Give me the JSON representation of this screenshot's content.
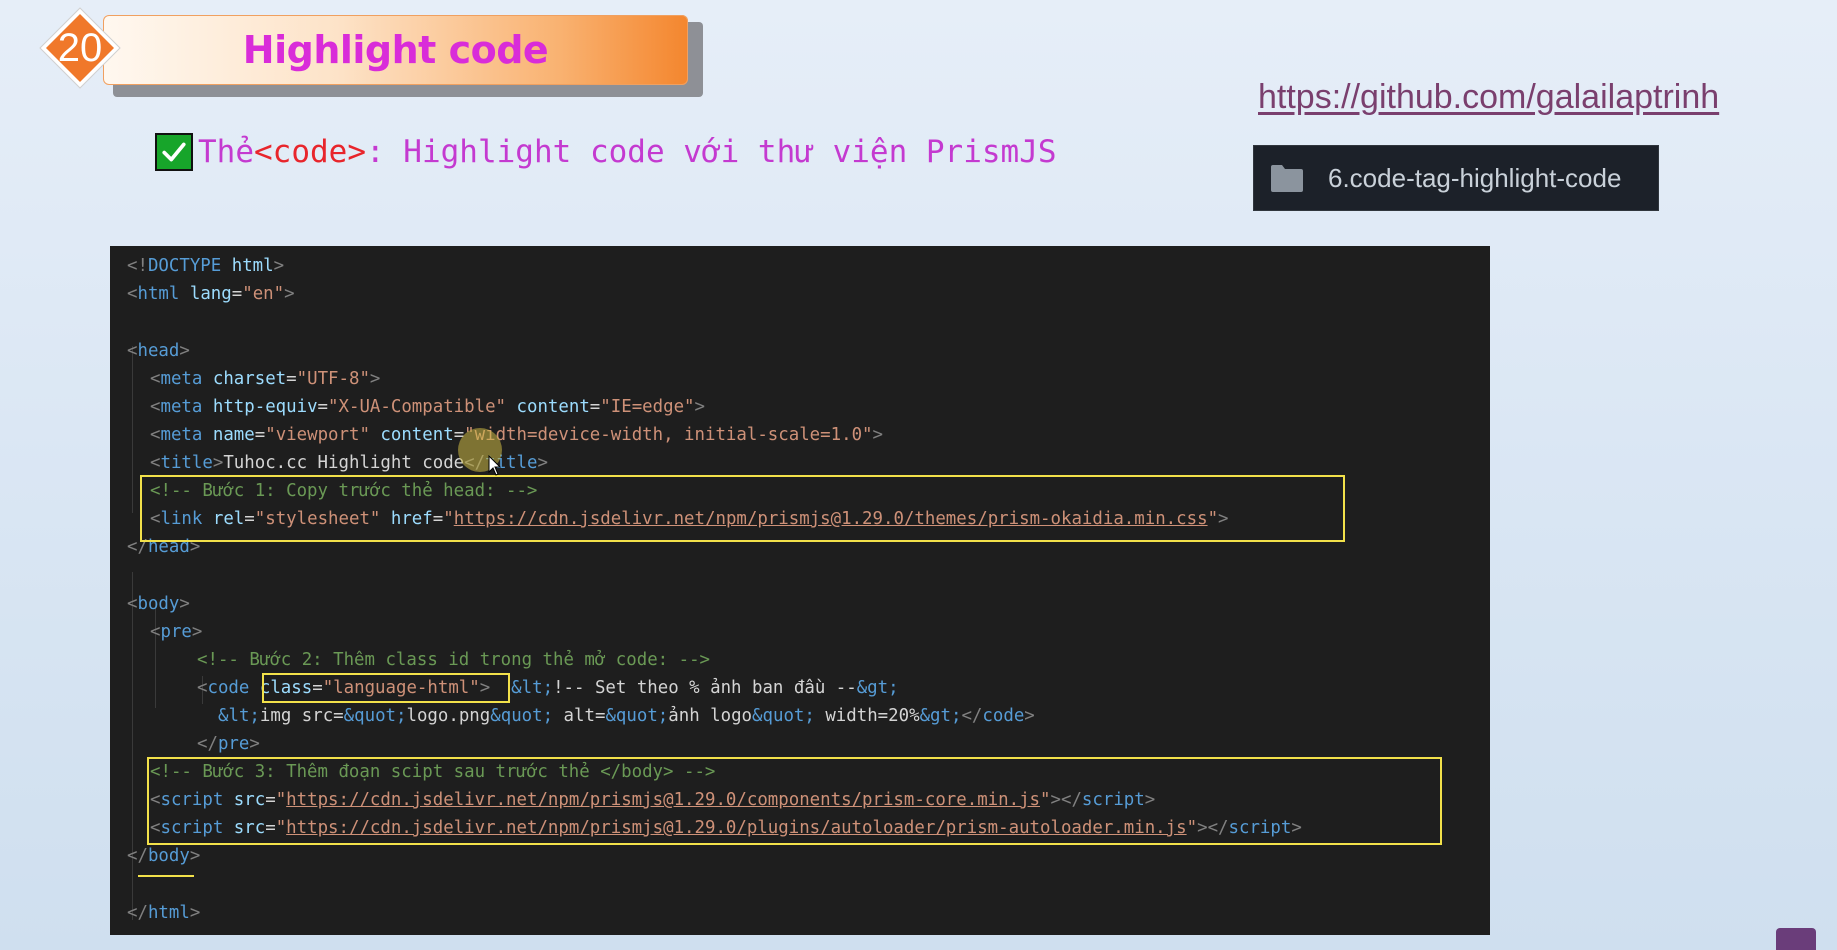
{
  "slide": {
    "number": "20",
    "title": "Highlight code",
    "subtitle_prefix": "Thẻ ",
    "subtitle_tag": "<code>",
    "subtitle_rest": ": Highlight code với thư viện PrismJS",
    "github_url": "https://github.com/galailaptrinh",
    "folder_name": "6.code-tag-highlight-code"
  },
  "colors": {
    "title": "#d92cd9",
    "badge": "#f0782a",
    "highlight_box": "#f2e14a",
    "editor_bg": "#1e1e1e"
  },
  "code": {
    "l1_a": "<!",
    "l1_b": "DOCTYPE",
    "l1_c": " html",
    "l1_d": ">",
    "l2_a": "<",
    "l2_b": "html",
    "l2_c": " lang",
    "l2_d": "=",
    "l2_e": "\"en\"",
    "l2_f": ">",
    "l4_a": "<",
    "l4_b": "head",
    "l4_c": ">",
    "l5_a": "<",
    "l5_b": "meta",
    "l5_c": " charset",
    "l5_d": "=",
    "l5_e": "\"UTF-8\"",
    "l5_f": ">",
    "l6_a": "<",
    "l6_b": "meta",
    "l6_c": " http-equiv",
    "l6_d": "=",
    "l6_e": "\"X-UA-Compatible\"",
    "l6_f": " content",
    "l6_g": "=",
    "l6_h": "\"IE=edge\"",
    "l6_i": ">",
    "l7_a": "<",
    "l7_b": "meta",
    "l7_c": " name",
    "l7_d": "=",
    "l7_e": "\"viewport\"",
    "l7_f": " content",
    "l7_g": "=",
    "l7_h": "\"width=device-width, initial-scale=1.0\"",
    "l7_i": ">",
    "l8_a": "<",
    "l8_b": "title",
    "l8_c": ">",
    "l8_d": "Tuhoc.cc Highlight code",
    "l8_e": "</",
    "l8_f": "title",
    "l8_g": ">",
    "l9": "<!-- Bước 1: Copy trước thẻ head: -->",
    "l10_a": "<",
    "l10_b": "link",
    "l10_c": " rel",
    "l10_d": "=",
    "l10_e": "\"stylesheet\"",
    "l10_f": " href",
    "l10_g": "=",
    "l10_h1": "\"",
    "l10_h2": "https://cdn.jsdelivr.net/npm/prismjs@1.29.0/themes/prism-okaidia.min.css",
    "l10_h3": "\"",
    "l10_i": ">",
    "l11_a": "</",
    "l11_b": "head",
    "l11_c": ">",
    "l13_a": "<",
    "l13_b": "body",
    "l13_c": ">",
    "l14_a": "<",
    "l14_b": "pre",
    "l14_c": ">",
    "l15": "<!-- Bước 2: Thêm class id trong thẻ mở code: -->",
    "l16_a": "<",
    "l16_b": "code",
    "l16_c": " class",
    "l16_d": "=",
    "l16_e": "\"language-html\"",
    "l16_f": ">",
    "l16_g": "  &lt;",
    "l16_h": "!-- Set theo % ảnh ban đầu --",
    "l16_i": "&gt;",
    "l17_a": "&lt;",
    "l17_b": "img src=",
    "l17_c": "&quot;",
    "l17_d": "logo.png",
    "l17_e": "&quot;",
    "l17_f": " alt=",
    "l17_g": "&quot;",
    "l17_h": "ảnh logo",
    "l17_i": "&quot;",
    "l17_j": " width=20%",
    "l17_k": "&gt;",
    "l17_l": "</",
    "l17_m": "code",
    "l17_n": ">",
    "l18_a": "</",
    "l18_b": "pre",
    "l18_c": ">",
    "l19": "<!-- Bước 3: Thêm đoạn scipt sau trước thẻ </body> -->",
    "l20_a": "<",
    "l20_b": "script",
    "l20_c": " src",
    "l20_d": "=",
    "l20_e1": "\"",
    "l20_e2": "https://cdn.jsdelivr.net/npm/prismjs@1.29.0/components/prism-core.min.js",
    "l20_e3": "\"",
    "l20_f": "></",
    "l20_g": "script",
    "l20_h": ">",
    "l21_a": "<",
    "l21_b": "script",
    "l21_c": " src",
    "l21_d": "=",
    "l21_e1": "\"",
    "l21_e2": "https://cdn.jsdelivr.net/npm/prismjs@1.29.0/plugins/autoloader/prism-autoloader.min.js",
    "l21_e3": "\"",
    "l21_f": "></",
    "l21_g": "script",
    "l21_h": ">",
    "l22_a": "</",
    "l22_b": "body",
    "l22_c": ">",
    "l24_a": "</",
    "l24_b": "html",
    "l24_c": ">"
  }
}
